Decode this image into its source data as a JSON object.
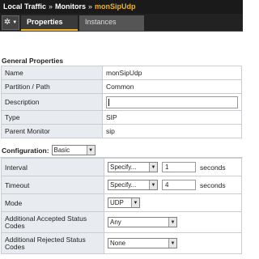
{
  "breadcrumb": {
    "items": [
      "Local Traffic",
      "Monitors"
    ],
    "current": "monSipUdp",
    "separator": "»"
  },
  "tabs": [
    {
      "label": "Properties",
      "active": true
    },
    {
      "label": "Instances",
      "active": false
    }
  ],
  "general": {
    "title": "General Properties",
    "rows": [
      {
        "label": "Name",
        "value": "monSipUdp"
      },
      {
        "label": "Partition / Path",
        "value": "Common"
      },
      {
        "label": "Description",
        "value": ""
      },
      {
        "label": "Type",
        "value": "SIP"
      },
      {
        "label": "Parent Monitor",
        "value": "sip"
      }
    ]
  },
  "configuration": {
    "label": "Configuration:",
    "mode_value": "Basic",
    "interval": {
      "label": "Interval",
      "select": "Specify...",
      "value": "1",
      "unit": "seconds"
    },
    "timeout": {
      "label": "Timeout",
      "select": "Specify...",
      "value": "4",
      "unit": "seconds"
    },
    "mode": {
      "label": "Mode",
      "value": "UDP"
    },
    "accepted": {
      "label": "Additional Accepted Status Codes",
      "value": "Any"
    },
    "rejected": {
      "label": "Additional Rejected Status Codes",
      "value": "None"
    }
  },
  "colors": {
    "accent": "#f0b429",
    "header_bg": "#1a1a1a",
    "label_bg": "#e8ecf0"
  }
}
